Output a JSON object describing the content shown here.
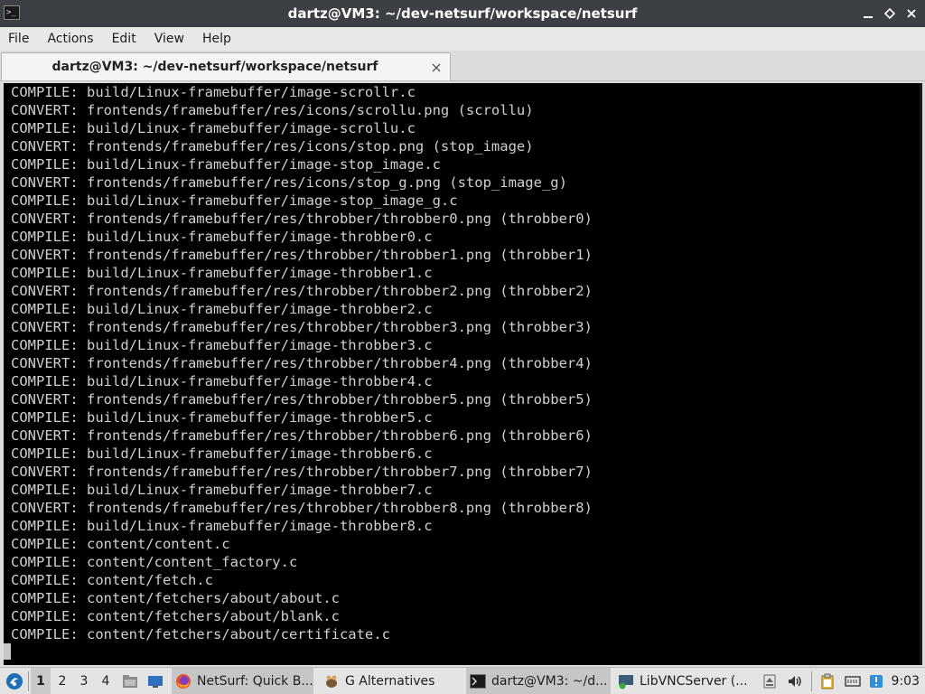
{
  "window": {
    "title": "dartz@VM3: ~/dev-netsurf/workspace/netsurf"
  },
  "menu": [
    "File",
    "Actions",
    "Edit",
    "View",
    "Help"
  ],
  "tab": {
    "label": "dartz@VM3: ~/dev-netsurf/workspace/netsurf"
  },
  "terminal": {
    "lines": [
      "COMPILE: build/Linux-framebuffer/image-scrollr.c",
      "CONVERT: frontends/framebuffer/res/icons/scrollu.png (scrollu)",
      "COMPILE: build/Linux-framebuffer/image-scrollu.c",
      "CONVERT: frontends/framebuffer/res/icons/stop.png (stop_image)",
      "COMPILE: build/Linux-framebuffer/image-stop_image.c",
      "CONVERT: frontends/framebuffer/res/icons/stop_g.png (stop_image_g)",
      "COMPILE: build/Linux-framebuffer/image-stop_image_g.c",
      "CONVERT: frontends/framebuffer/res/throbber/throbber0.png (throbber0)",
      "COMPILE: build/Linux-framebuffer/image-throbber0.c",
      "CONVERT: frontends/framebuffer/res/throbber/throbber1.png (throbber1)",
      "COMPILE: build/Linux-framebuffer/image-throbber1.c",
      "CONVERT: frontends/framebuffer/res/throbber/throbber2.png (throbber2)",
      "COMPILE: build/Linux-framebuffer/image-throbber2.c",
      "CONVERT: frontends/framebuffer/res/throbber/throbber3.png (throbber3)",
      "COMPILE: build/Linux-framebuffer/image-throbber3.c",
      "CONVERT: frontends/framebuffer/res/throbber/throbber4.png (throbber4)",
      "COMPILE: build/Linux-framebuffer/image-throbber4.c",
      "CONVERT: frontends/framebuffer/res/throbber/throbber5.png (throbber5)",
      "COMPILE: build/Linux-framebuffer/image-throbber5.c",
      "CONVERT: frontends/framebuffer/res/throbber/throbber6.png (throbber6)",
      "COMPILE: build/Linux-framebuffer/image-throbber6.c",
      "CONVERT: frontends/framebuffer/res/throbber/throbber7.png (throbber7)",
      "COMPILE: build/Linux-framebuffer/image-throbber7.c",
      "CONVERT: frontends/framebuffer/res/throbber/throbber8.png (throbber8)",
      "COMPILE: build/Linux-framebuffer/image-throbber8.c",
      "COMPILE: content/content.c",
      "COMPILE: content/content_factory.c",
      "COMPILE: content/fetch.c",
      "COMPILE: content/fetchers/about/about.c",
      "COMPILE: content/fetchers/about/blank.c",
      "COMPILE: content/fetchers/about/certificate.c"
    ]
  },
  "taskbar": {
    "workspaces": [
      "1",
      "2",
      "3",
      "4"
    ],
    "tasks": [
      {
        "label": "NetSurf: Quick B...",
        "icon": "firefox-icon"
      },
      {
        "label": "G Alternatives",
        "icon": "gnome-alternatives-icon"
      },
      {
        "label": "dartz@VM3: ~/d...",
        "icon": "terminal-icon"
      },
      {
        "label": "LibVNCServer (...",
        "icon": "vnc-icon"
      }
    ],
    "clock": "9:03"
  }
}
